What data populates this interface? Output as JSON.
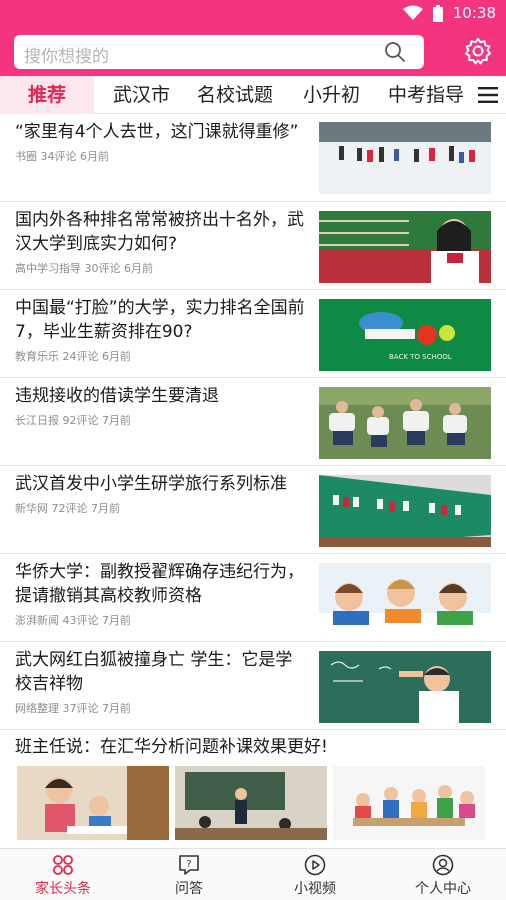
{
  "status_bar": {
    "time": "10:38",
    "icons": [
      "wifi-icon",
      "battery-icon"
    ]
  },
  "search": {
    "placeholder": "搜你想搜的",
    "icon": "search-icon"
  },
  "header": {
    "settings_icon": "gear-icon"
  },
  "tabs": [
    {
      "label": "推荐",
      "active": true
    },
    {
      "label": "武汉市"
    },
    {
      "label": "名校试题"
    },
    {
      "label": "小升初"
    },
    {
      "label": "中考指导"
    }
  ],
  "articles": [
    {
      "title": "“家里有4个人去世，这门课就得重修”",
      "meta": "书圈 34评论 6月前",
      "image": "children playing in snow"
    },
    {
      "title": "国内外各种排名常常被挤出十名外，武汉大学到底实力如何?",
      "meta": "高中学习指导 30评论 6月前",
      "image": "smiling student girl"
    },
    {
      "title": "中国最“打脸”的大学，实力排名全国前7，毕业生薪资排在90?",
      "meta": "教育乐乐 24评论 6月前",
      "image": "back to school graphic"
    },
    {
      "title": "违规接收的借读学生要清退",
      "meta": "长江日报 92评论 7月前",
      "image": "students sitting on grass"
    },
    {
      "title": "武汉首发中小学生研学旅行系列标准",
      "meta": "新华网 72评论 7月前",
      "image": "school wall with flags"
    },
    {
      "title": "华侨大学：副教授翟辉确存违纪行为，提请撤销其高校教师资格",
      "meta": "澎湃新闻 43评论 7月前",
      "image": "children reading"
    },
    {
      "title": "武大网红白狐被撞身亡 学生：它是学校吉祥物",
      "meta": "网络整理 37评论 7月前",
      "image": "boy writing on chalkboard"
    }
  ],
  "multi_image_post": {
    "title": "班主任说：在汇华分析问题补课效果更好!",
    "images": [
      "teacher with student",
      "classroom lecture",
      "kids at table"
    ]
  },
  "bottom_nav": [
    {
      "label": "家长头条",
      "icon": "headline-icon",
      "active": true
    },
    {
      "label": "问答",
      "icon": "qa-icon"
    },
    {
      "label": "小视频",
      "icon": "video-icon"
    },
    {
      "label": "个人中心",
      "icon": "profile-icon"
    }
  ],
  "colors": {
    "brand": "#f5347f",
    "accent_red": "#e8254f"
  }
}
